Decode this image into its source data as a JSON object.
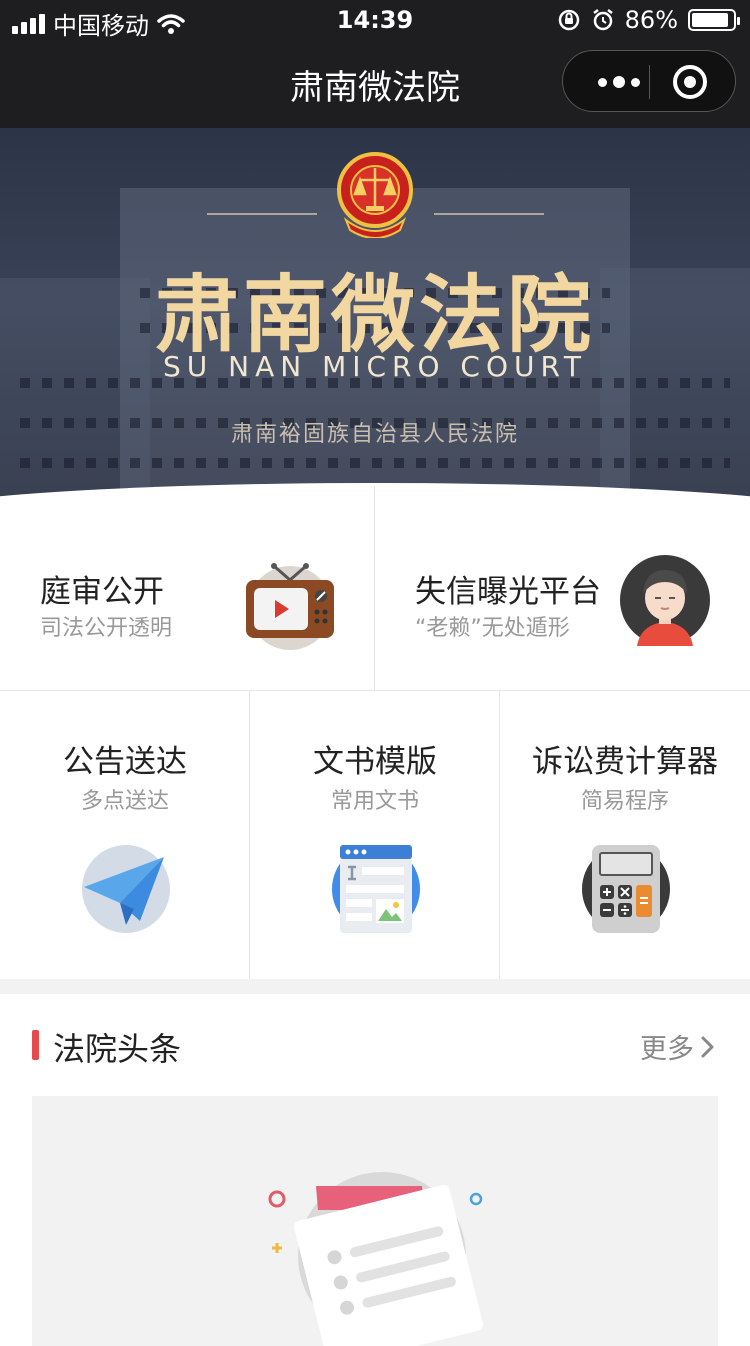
{
  "status_bar": {
    "carrier": "中国移动",
    "time": "14:39",
    "battery": "86%",
    "battery_level": 0.86
  },
  "nav": {
    "title": "肃南微法院"
  },
  "banner": {
    "title": "肃南微法院",
    "subtitle": "SU NAN MICRO COURT",
    "court_name": "肃南裕固族自治县人民法院"
  },
  "tiles_top": [
    {
      "title": "庭审公开",
      "subtitle": "司法公开透明",
      "icon": "tv-play-icon"
    },
    {
      "title": "失信曝光平台",
      "subtitle": "“老赖”无处遁形",
      "icon": "person-avatar-icon"
    }
  ],
  "tiles_bottom": [
    {
      "title": "公告送达",
      "subtitle": "多点送达",
      "icon": "paper-plane-icon"
    },
    {
      "title": "文书模版",
      "subtitle": "常用文书",
      "icon": "document-template-icon"
    },
    {
      "title": "诉讼费计算器",
      "subtitle": "简易程序",
      "icon": "calculator-icon"
    }
  ],
  "news": {
    "title": "法院头条",
    "more_label": "更多"
  },
  "colors": {
    "dark_bar": "#1e1e20",
    "accent_red": "#e5484d",
    "banner_gold": "#f3d7a0"
  }
}
